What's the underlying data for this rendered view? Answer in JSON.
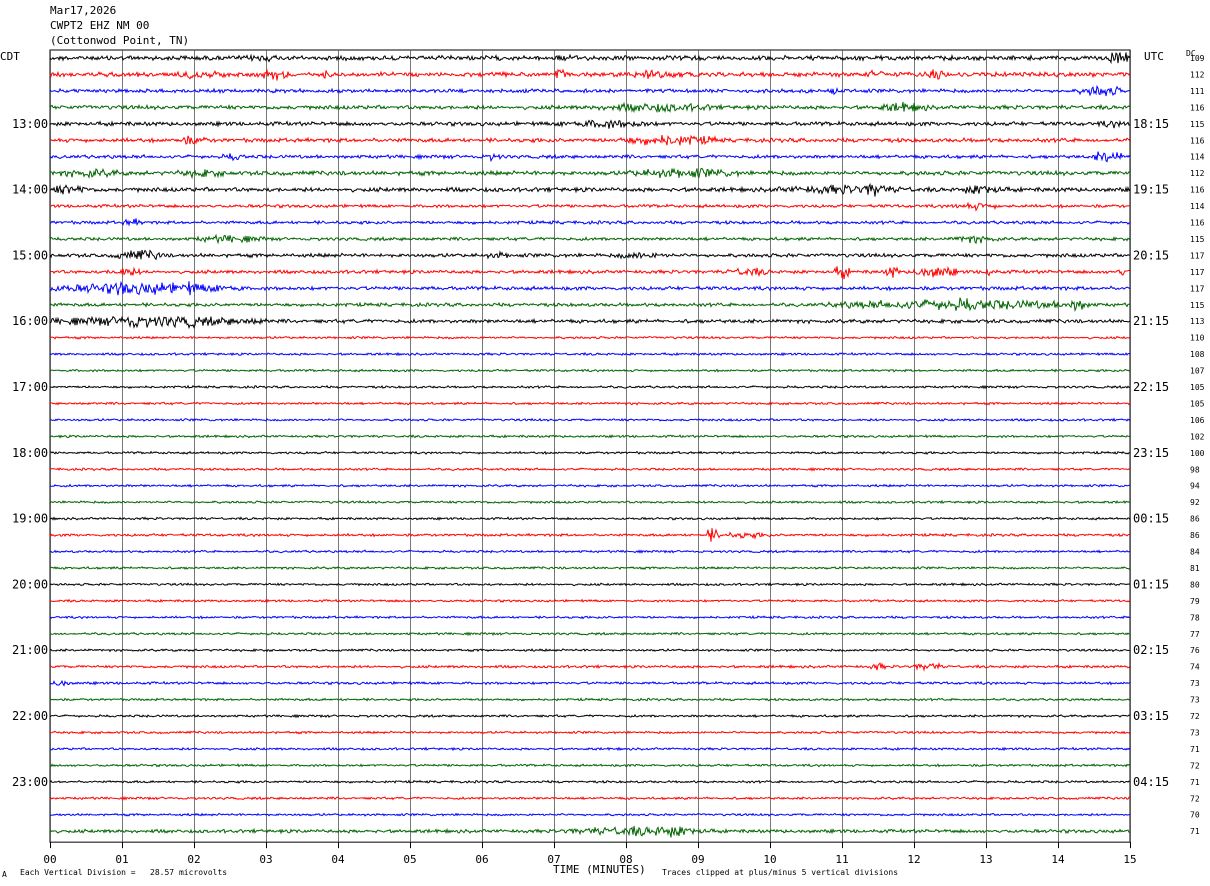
{
  "header": {
    "date": "Mar17,2026",
    "station": "CWPT2 EHZ NM 00",
    "location": "(Cottonwod Point, TN)"
  },
  "left_tz": "CDT",
  "right_tz": "UTC",
  "dc_label": "DC",
  "footer": {
    "scale_note": "Each Vertical Division =   28.57 microvolts",
    "x_title": "TIME (MINUTES)",
    "clip_note": "Traces clipped at plus/minus 5 vertical divisions",
    "corner_mark": "A"
  },
  "chart_data": {
    "type": "line",
    "title": "CWPT2 EHZ NM 00 (Cottonwod Point, TN)",
    "xlabel": "TIME (MINUTES)",
    "xlim": [
      0,
      15
    ],
    "x_ticks": [
      "00",
      "01",
      "02",
      "03",
      "04",
      "05",
      "06",
      "07",
      "08",
      "09",
      "10",
      "11",
      "12",
      "13",
      "14",
      "15"
    ],
    "trace_colors": [
      "#000000",
      "#ff0000",
      "#0000ff",
      "#006400"
    ],
    "left_time_labels": [
      "13:00",
      "14:00",
      "15:00",
      "16:00",
      "17:00",
      "18:00",
      "19:00",
      "20:00",
      "21:00",
      "22:00",
      "23:00"
    ],
    "right_time_labels": [
      "18:15",
      "19:15",
      "20:15",
      "21:15",
      "22:15",
      "23:15",
      "00:15",
      "01:15",
      "02:15",
      "03:15",
      "04:15"
    ],
    "dc_offsets": [
      109,
      112,
      111,
      116,
      115,
      116,
      114,
      112,
      116,
      114,
      116,
      115,
      117,
      117,
      117,
      115,
      113,
      110,
      108,
      107,
      105,
      105,
      106,
      102,
      100,
      98,
      94,
      92,
      86,
      86,
      84,
      81,
      80,
      79,
      78,
      77,
      76,
      74,
      73,
      73,
      72,
      73,
      71,
      72,
      71,
      72,
      70,
      71
    ],
    "trace_activity": [
      {
        "trace": 0,
        "level": 1.6,
        "bursts": [
          [
            2.7,
            3.2,
            1.7
          ],
          [
            6.9,
            7.4,
            1.5
          ],
          [
            14.7,
            15,
            3.0
          ]
        ]
      },
      {
        "trace": 1,
        "level": 1.6,
        "bursts": [
          [
            1.6,
            2.5,
            2.0
          ],
          [
            2.9,
            3.4,
            2.4
          ],
          [
            3.8,
            3.9,
            2.2
          ],
          [
            7.0,
            7.2,
            3.0
          ],
          [
            8.0,
            8.8,
            2.0
          ],
          [
            11.3,
            11.6,
            2.2
          ],
          [
            12.2,
            12.4,
            2.5
          ]
        ]
      },
      {
        "trace": 2,
        "level": 1.3,
        "bursts": [
          [
            14.3,
            14.9,
            2.5
          ],
          [
            10.8,
            11.0,
            1.8
          ]
        ]
      },
      {
        "trace": 3,
        "level": 1.4,
        "bursts": [
          [
            7.5,
            9.3,
            2.0
          ],
          [
            11.5,
            12.2,
            2.2
          ]
        ]
      },
      {
        "trace": 4,
        "level": 1.4,
        "bursts": [
          [
            7.0,
            8.4,
            2.0
          ],
          [
            14.5,
            15,
            1.6
          ]
        ]
      },
      {
        "trace": 5,
        "level": 1.4,
        "bursts": [
          [
            1.7,
            2.2,
            2.0
          ],
          [
            7.9,
            9.3,
            2.5
          ]
        ]
      },
      {
        "trace": 6,
        "level": 1.2,
        "bursts": [
          [
            14.5,
            14.9,
            3.0
          ],
          [
            2.4,
            2.7,
            1.8
          ],
          [
            6.0,
            6.3,
            1.6
          ]
        ]
      },
      {
        "trace": 7,
        "level": 1.5,
        "bursts": [
          [
            0.1,
            1.0,
            2.0
          ],
          [
            8.0,
            9.6,
            2.3
          ],
          [
            1.7,
            2.5,
            1.8
          ]
        ]
      },
      {
        "trace": 8,
        "level": 1.5,
        "bursts": [
          [
            0.0,
            0.5,
            2.5
          ],
          [
            10.0,
            12.0,
            2.0
          ],
          [
            11.3,
            11.6,
            3.5
          ],
          [
            12.6,
            13.3,
            2.3
          ]
        ]
      },
      {
        "trace": 9,
        "level": 1.1,
        "bursts": [
          [
            12.5,
            13.2,
            1.6
          ]
        ]
      },
      {
        "trace": 10,
        "level": 1.1,
        "bursts": [
          [
            1.0,
            1.3,
            1.8
          ]
        ]
      },
      {
        "trace": 11,
        "level": 1.1,
        "bursts": [
          [
            2.0,
            3.0,
            1.7
          ],
          [
            12.5,
            13.2,
            1.7
          ]
        ]
      },
      {
        "trace": 12,
        "level": 1.3,
        "bursts": [
          [
            0.9,
            1.6,
            2.4
          ],
          [
            6.0,
            6.5,
            1.5
          ],
          [
            7.8,
            8.6,
            1.7
          ]
        ]
      },
      {
        "trace": 13,
        "level": 1.2,
        "bursts": [
          [
            0.8,
            1.3,
            2.0
          ],
          [
            9.4,
            10.0,
            1.9
          ],
          [
            10.9,
            11.1,
            3.2
          ],
          [
            11.6,
            11.8,
            2.8
          ],
          [
            12.0,
            12.6,
            2.7
          ],
          [
            13.0,
            13.1,
            3.2
          ],
          [
            14.8,
            15,
            2.0
          ]
        ]
      },
      {
        "trace": 14,
        "level": 1.3,
        "bursts": [
          [
            0.0,
            2.7,
            2.6
          ],
          [
            0.9,
            1.1,
            4.0
          ],
          [
            1.8,
            2.1,
            3.0
          ]
        ]
      },
      {
        "trace": 15,
        "level": 1.2,
        "bursts": [
          [
            10.8,
            14.5,
            2.3
          ],
          [
            12.5,
            12.9,
            3.2
          ],
          [
            14.1,
            14.4,
            3.0
          ]
        ]
      },
      {
        "trace": 16,
        "level": 1.3,
        "bursts": [
          [
            0.0,
            3.0,
            2.4
          ],
          [
            1.0,
            1.3,
            3.4
          ],
          [
            1.8,
            2.1,
            3.0
          ]
        ]
      },
      {
        "trace": 29,
        "level": 0.9,
        "bursts": [
          [
            9.1,
            9.3,
            3.0
          ],
          [
            9.3,
            10.0,
            1.4
          ]
        ]
      },
      {
        "trace": 37,
        "level": 0.9,
        "bursts": [
          [
            11.4,
            11.6,
            1.8
          ],
          [
            12.0,
            12.4,
            1.8
          ]
        ]
      },
      {
        "trace": 38,
        "level": 0.9,
        "bursts": [
          [
            0.0,
            0.3,
            1.6
          ]
        ]
      },
      {
        "trace": 47,
        "level": 1.2,
        "bursts": [
          [
            7.1,
            9.2,
            2.0
          ],
          [
            8.2,
            9.0,
            2.6
          ]
        ]
      }
    ],
    "quiet_level": 0.8,
    "rows": 48,
    "minutes_per_row": 15
  }
}
